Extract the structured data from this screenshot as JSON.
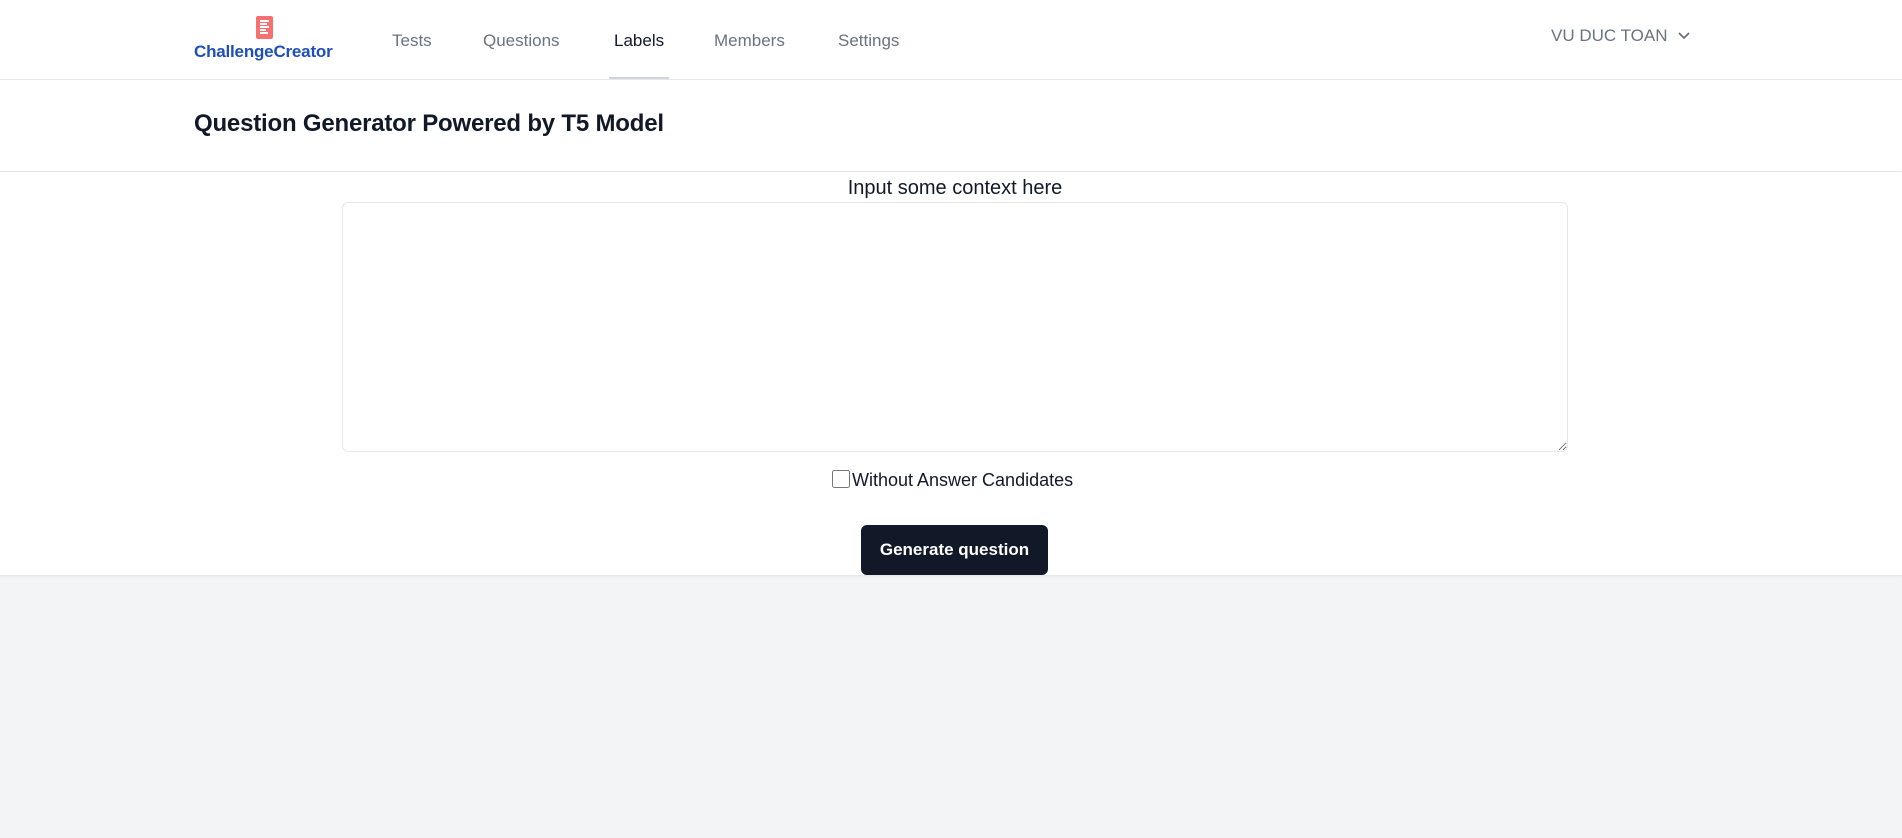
{
  "brand": {
    "name": "ChallengeCreator",
    "logo_color": "#f87171",
    "text_color": "#1e4fb8"
  },
  "nav": {
    "items": [
      {
        "label": "Tests"
      },
      {
        "label": "Questions"
      },
      {
        "label": "Labels",
        "active": true
      },
      {
        "label": "Members"
      },
      {
        "label": "Settings"
      }
    ]
  },
  "user": {
    "name": "VU DUC TOAN",
    "icon": "chevron-down-icon"
  },
  "page": {
    "title": "Question Generator Powered by T5 Model"
  },
  "form": {
    "context_label": "Input some context here",
    "context_value": "",
    "context_placeholder": "",
    "checkbox_label": "Without Answer Candidates",
    "checkbox_checked": false,
    "generate_label": "Generate question",
    "button_color": "#111827"
  }
}
